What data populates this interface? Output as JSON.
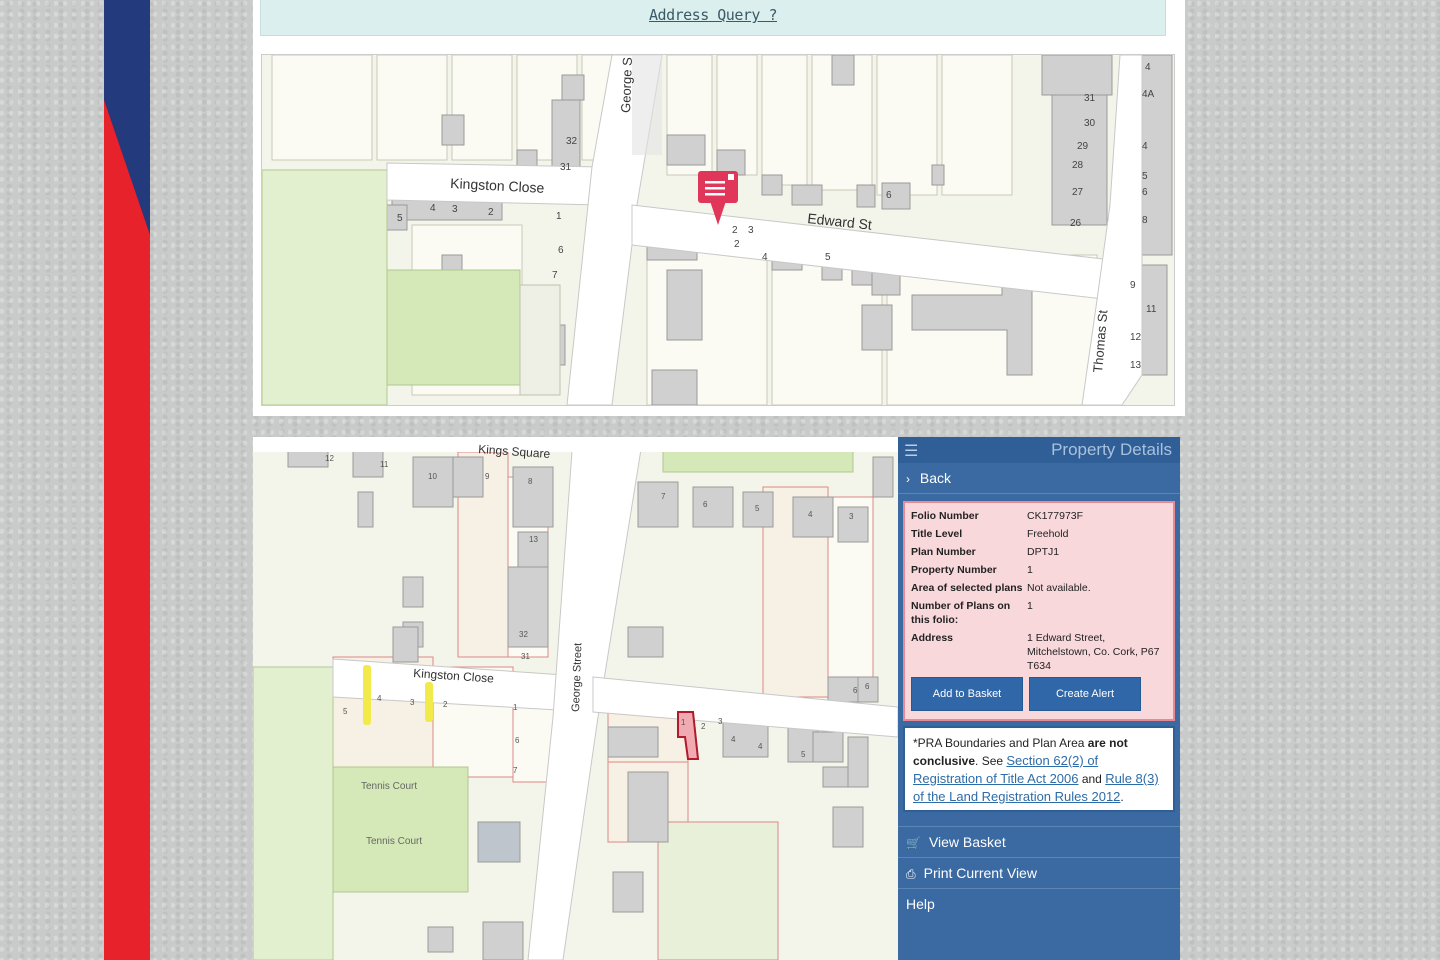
{
  "address_query": "Address Query ?",
  "map1": {
    "streets": {
      "kingston": "Kingston Close",
      "edward": "Edward St",
      "george": "George S",
      "thomas": "Thomas St"
    },
    "numbers": [
      "5",
      "4",
      "3",
      "2",
      "1",
      "6",
      "7",
      "32",
      "31",
      "2",
      "3",
      "2",
      "4",
      "5",
      "6",
      "31",
      "30",
      "29",
      "28",
      "27",
      "26",
      "4",
      "4A",
      "4",
      "5",
      "6",
      "8",
      "9",
      "11",
      "12",
      "13"
    ]
  },
  "map2": {
    "streets": {
      "kings_square": "Kings Square",
      "kingston": "Kingston Close",
      "george": "George Street"
    },
    "courts": [
      "Tennis Court",
      "Tennis Court"
    ],
    "numbers": [
      "12",
      "11",
      "10",
      "9",
      "8",
      "7",
      "6",
      "5",
      "4",
      "3",
      "13",
      "32",
      "31",
      "5",
      "4",
      "3",
      "2",
      "1",
      "6",
      "7",
      "1",
      "2",
      "3",
      "4",
      "4",
      "5",
      "6",
      "6"
    ]
  },
  "panel": {
    "title": "Property Details",
    "back": "Back",
    "details": [
      {
        "label": "Folio Number",
        "value": "CK177973F"
      },
      {
        "label": "Title Level",
        "value": "Freehold"
      },
      {
        "label": "Plan Number",
        "value": "DPTJ1"
      },
      {
        "label": "Property Number",
        "value": "1"
      },
      {
        "label": "Area of selected plans",
        "value": "Not available."
      },
      {
        "label": "Number of Plans on this folio:",
        "value": "1"
      },
      {
        "label": "Address",
        "value": "1 Edward Street, Mitchelstown, Co. Cork, P67 T634"
      }
    ],
    "add_basket": "Add to Basket",
    "create_alert": "Create Alert",
    "notice": {
      "p1": "*PRA Boundaries and Plan Area ",
      "bold": "are not conclusive",
      "p2": ". See ",
      "link1": "Section 62(2) of Registration of Title Act 2006",
      "p3": " and ",
      "link2": "Rule 8(3) of the Land Registration Rules 2012",
      "p4": "."
    },
    "view_basket": "View Basket",
    "print_view": "Print Current View",
    "help": "Help"
  }
}
